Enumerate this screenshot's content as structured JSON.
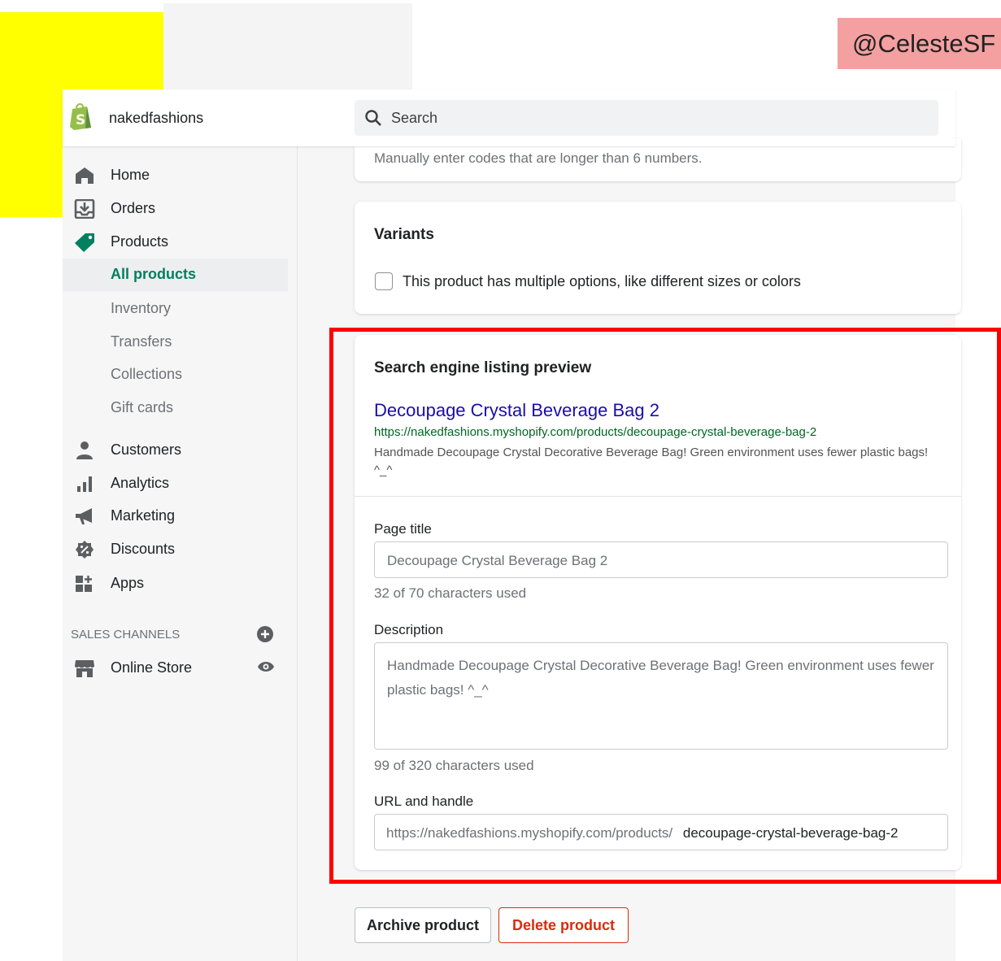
{
  "watermark": "@CelesteSF",
  "store": {
    "name": "nakedfashions"
  },
  "search": {
    "placeholder": "Search"
  },
  "nav": {
    "home": "Home",
    "orders": "Orders",
    "products": "Products",
    "all_products": "All products",
    "inventory": "Inventory",
    "transfers": "Transfers",
    "collections": "Collections",
    "gift_cards": "Gift cards",
    "customers": "Customers",
    "analytics": "Analytics",
    "marketing": "Marketing",
    "discounts": "Discounts",
    "apps": "Apps",
    "sales_channels_title": "SALES CHANNELS",
    "online_store": "Online Store"
  },
  "barcode_card": {
    "help": "Manually enter codes that are longer than 6 numbers."
  },
  "variants": {
    "title": "Variants",
    "checkbox_label": "This product has multiple options, like different sizes or colors",
    "checked": false
  },
  "seo": {
    "title": "Search engine listing preview",
    "preview_title": "Decoupage Crystal Beverage Bag 2",
    "preview_url": "https://nakedfashions.myshopify.com/products/decoupage-crystal-beverage-bag-2",
    "preview_description": "Handmade Decoupage Crystal Decorative Beverage Bag! Green environment uses fewer plastic bags! ^_^",
    "page_title_label": "Page title",
    "page_title_value": "Decoupage Crystal Beverage Bag 2",
    "page_title_count": "32 of 70 characters used",
    "description_label": "Description",
    "description_value": "Handmade Decoupage Crystal Decorative Beverage Bag! Green environment uses fewer plastic bags! ^_^",
    "description_count": "99 of 320 characters used",
    "url_label": "URL and handle",
    "url_prefix": "https://nakedfashions.myshopify.com/products/",
    "url_handle": "decoupage-crystal-beverage-bag-2"
  },
  "actions": {
    "archive": "Archive product",
    "delete": "Delete product"
  },
  "colors": {
    "accent_green": "#007f5f",
    "link_purple": "#1a0dab",
    "url_green": "#006621",
    "danger": "#d82c0d",
    "highlight_red": "#ff0000",
    "highlight_yellow": "#ffff00"
  },
  "icons": {
    "logo": "shopify-bag-icon",
    "search": "search-icon",
    "home": "home-icon",
    "orders": "orders-inbox-icon",
    "products": "tag-icon",
    "customers": "person-icon",
    "analytics": "bar-chart-icon",
    "marketing": "megaphone-icon",
    "discounts": "discount-badge-icon",
    "apps": "apps-grid-icon",
    "add_channel": "plus-circle-icon",
    "online_store": "store-icon",
    "view": "eye-icon"
  }
}
